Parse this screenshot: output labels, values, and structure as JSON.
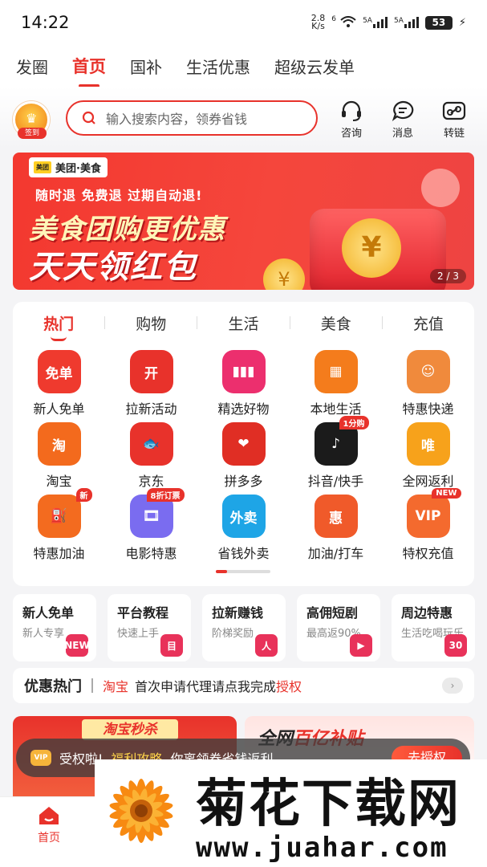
{
  "status": {
    "time": "14:22",
    "net_speed": "2.8",
    "net_unit": "K/s",
    "wifi_label": "6",
    "sig1_label": "5A",
    "sig2_label": "5A",
    "battery": "53"
  },
  "topnav": {
    "tabs": [
      {
        "label": "发圈"
      },
      {
        "label": "首页"
      },
      {
        "label": "国补"
      },
      {
        "label": "生活优惠"
      },
      {
        "label": "超级云发单"
      }
    ],
    "active": "首页"
  },
  "header": {
    "sign_label": "签到",
    "search_placeholder": "输入搜索内容，领券省钱",
    "consult": "咨询",
    "message": "消息",
    "convert": "转链"
  },
  "banner": {
    "brand": "美团·美食",
    "brand_logo": "美团",
    "tagline": "随时退 免费退 过期自动退!",
    "headline1": "美食团购更优惠",
    "headline2": "天天领红包",
    "coin_symbol": "¥",
    "pager": "2 / 3"
  },
  "categories": {
    "tabs": [
      {
        "label": "热门"
      },
      {
        "label": "购物"
      },
      {
        "label": "生活"
      },
      {
        "label": "美食"
      },
      {
        "label": "充值"
      }
    ],
    "items": [
      {
        "label": "新人免单",
        "icon_text": "免单",
        "color": "#ef3a2e",
        "tag": ""
      },
      {
        "label": "拉新活动",
        "icon_text": "开",
        "color": "#e8322b",
        "tag": ""
      },
      {
        "label": "精选好物",
        "icon_text": "▮▮▮",
        "color": "#ec2f6e",
        "tag": ""
      },
      {
        "label": "本地生活",
        "icon_text": "▦",
        "color": "#f47c1c",
        "tag": ""
      },
      {
        "label": "特惠快递",
        "icon_text": "☺",
        "color": "#f08a3c",
        "tag": ""
      },
      {
        "label": "淘宝",
        "icon_text": "淘",
        "color": "#f36a1d",
        "tag": ""
      },
      {
        "label": "京东",
        "icon_text": "🐟",
        "color": "#e8322b",
        "tag": ""
      },
      {
        "label": "拼多多",
        "icon_text": "❤",
        "color": "#e02e24",
        "tag": ""
      },
      {
        "label": "抖音/快手",
        "icon_text": "♪",
        "color": "#1b1b1b",
        "tag": "1分购"
      },
      {
        "label": "全网返利",
        "icon_text": "唯",
        "color": "#f7a21b",
        "tag": ""
      },
      {
        "label": "特惠加油",
        "icon_text": "⛽",
        "color": "#f36b1f",
        "tag": "新"
      },
      {
        "label": "电影特惠",
        "icon_text": "🎞",
        "color": "#7a6cf0",
        "tag": "8折订票"
      },
      {
        "label": "省钱外卖",
        "icon_text": "外卖",
        "color": "#1ea5e6",
        "tag": ""
      },
      {
        "label": "加油/打车",
        "icon_text": "惠",
        "color": "#f05a2a",
        "tag": ""
      },
      {
        "label": "特权充值",
        "icon_text": "VIP",
        "color": "#f46a2e",
        "tag": "NEW"
      }
    ]
  },
  "cards": [
    {
      "title": "新人免单",
      "sub": "新人专享",
      "badge": "NEW"
    },
    {
      "title": "平台教程",
      "sub": "快速上手",
      "badge": "目"
    },
    {
      "title": "拉新赚钱",
      "sub": "阶梯奖励",
      "badge": "人"
    },
    {
      "title": "高佣短剧",
      "sub": "最高返90%",
      "badge": "▶"
    },
    {
      "title": "周边特惠",
      "sub": "生活吃喝玩乐",
      "badge": "30"
    }
  ],
  "hot": {
    "title": "优惠热门",
    "platform": "淘宝",
    "text": "首次申请代理请点我完成",
    "link": "授权"
  },
  "promos": {
    "left_title": "淘宝秒杀",
    "right_title_a": "全网",
    "right_title_b": "百亿补贴"
  },
  "toast": {
    "vip": "VIP",
    "text": "受权啦!",
    "highlight": "福利攻略",
    "text2": "你离领券省钱返利",
    "button": "去授权"
  },
  "bottomnav": {
    "home": "首页"
  },
  "watermark": {
    "title": "菊花下载网",
    "url": "www.juahar.com"
  }
}
